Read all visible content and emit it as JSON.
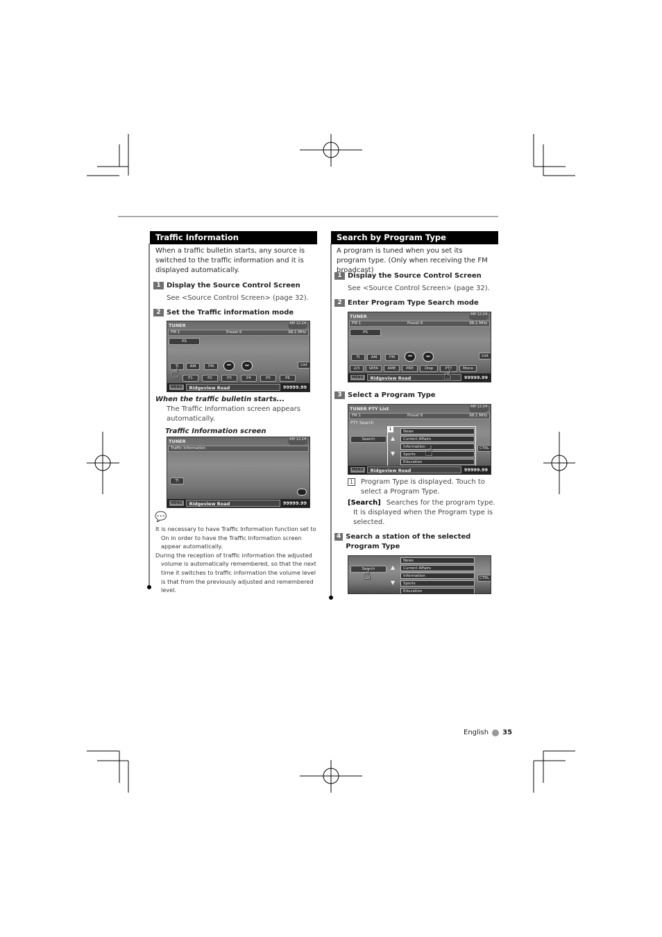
{
  "left": {
    "title": "Traffic Information",
    "intro": "When a traffic bulletin starts, any source is switched to the traffic information and it is displayed automatically.",
    "steps": [
      {
        "num": "1",
        "label": "Display the Source Control Screen",
        "sub": "See <Source Control Screen> (page 32)."
      },
      {
        "num": "2",
        "label": "Set the Traffic information mode"
      }
    ],
    "when_title": "When the traffic bulletin starts...",
    "when_text": "The Traffic Information screen appears automatically.",
    "screen_caption": "Traffic Information screen",
    "notes": [
      "It is necessary to have Traffic Information function set to On in order to have the Traffic Information screen appear automatically.",
      "During the reception of traffic information the adjusted volume is automatically remembered, so that the next time it switches to traffic information the volume level is that from the previously adjusted and remembered level."
    ]
  },
  "right": {
    "title": "Search by Program Type",
    "intro": "A program is tuned when you set its program type. (Only when receiving the FM broadcast)",
    "steps": [
      {
        "num": "1",
        "label": "Display the Source Control Screen",
        "sub": "See <Source Control Screen> (page 32)."
      },
      {
        "num": "2",
        "label": "Enter Program Type Search mode"
      },
      {
        "num": "3",
        "label": "Select a Program Type"
      },
      {
        "num": "4",
        "label": "Search a station of the selected Program Type"
      }
    ],
    "callout_num": "1",
    "callout_text": "Program Type is displayed. Touch to select a Program Type.",
    "search_key": "[Search]",
    "search_text": "Searches for the program type. It is displayed when the Program type is selected."
  },
  "screens": {
    "tuner": "TUNER",
    "pty_title": "TUNER PTY List",
    "clock": "AM 12:24",
    "band": "FM 1",
    "preset": "Preset 6",
    "freq": "98.1 MHz",
    "ps": "PS",
    "pty_search": "PTY Search",
    "ti": "TI",
    "am": "AM",
    "fm": "FM",
    "list": "List",
    "menu": "MENU",
    "road": "Ridgeview Road",
    "odo": "99999.99",
    "presets": [
      "P1",
      "P2",
      "P3",
      "P4",
      "P5",
      "P6"
    ],
    "func": [
      "2/3",
      "SEEK",
      "AME",
      "PRE",
      "Disp",
      "PTY",
      "Mono"
    ],
    "ti_info": "Traffic Information",
    "search": "Search",
    "ctrl": "CTRL",
    "pty_items": [
      "News",
      "Current Affairs",
      "Information",
      "Sports",
      "Education"
    ]
  },
  "footer": {
    "language": "English",
    "page": "35"
  }
}
